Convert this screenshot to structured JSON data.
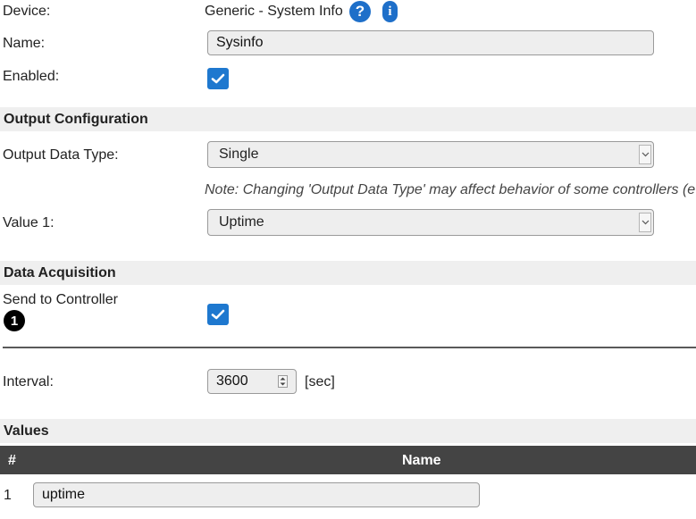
{
  "device": {
    "label": "Device:",
    "value": "Generic - System Info",
    "help_icon": "question-circle-icon",
    "info_icon": "info-circle-icon"
  },
  "name": {
    "label": "Name:",
    "value": "Sysinfo"
  },
  "enabled": {
    "label": "Enabled:",
    "checked": true
  },
  "output_config": {
    "heading": "Output Configuration",
    "data_type_label": "Output Data Type:",
    "data_type_value": "Single",
    "note": "Note: Changing 'Output Data Type' may affect behavior of some controllers (e",
    "value1_label": "Value 1:",
    "value1_value": "Uptime"
  },
  "data_acquisition": {
    "heading": "Data Acquisition",
    "send_label": "Send to Controller",
    "controller_number": "1",
    "send_checked": true,
    "interval_label": "Interval:",
    "interval_value": "3600",
    "interval_unit": "[sec]"
  },
  "values": {
    "heading": "Values",
    "columns": [
      "#",
      "Name"
    ],
    "rows": [
      {
        "index": "1",
        "name": "uptime"
      }
    ]
  },
  "colors": {
    "accent": "#1e78cf",
    "section_bg": "#efefef",
    "table_header_bg": "#444444"
  }
}
